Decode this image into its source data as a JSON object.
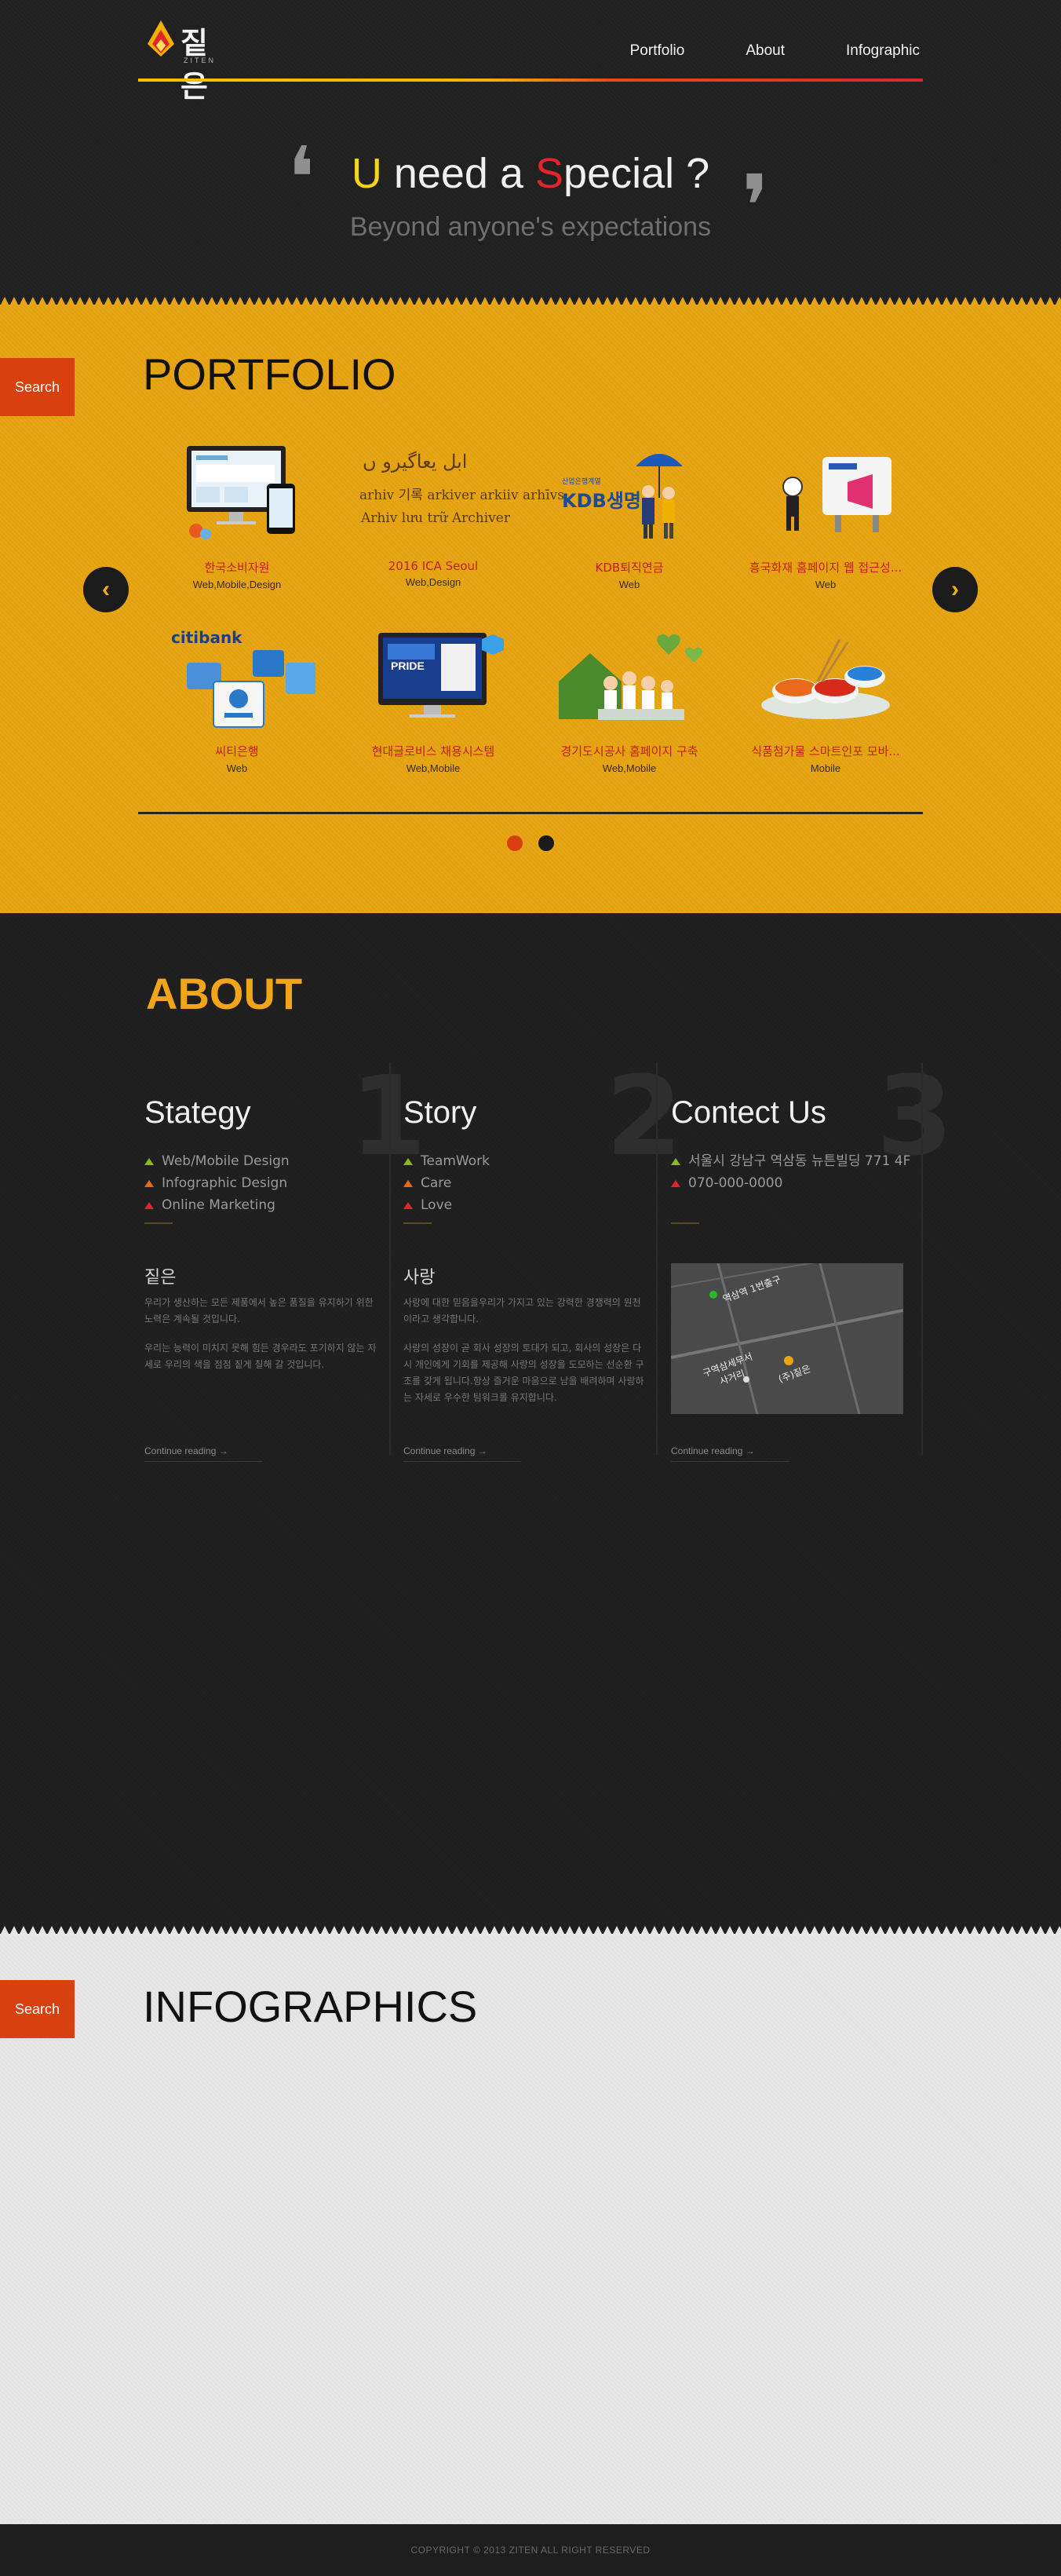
{
  "brand": {
    "name": "짙은",
    "sub": "ZITEN"
  },
  "nav": {
    "items": [
      "Portfolio",
      "About",
      "Infographic"
    ]
  },
  "hero": {
    "headline_u": "U",
    "headline_mid": " need a ",
    "headline_s": "S",
    "headline_rest": "pecial ?",
    "subline": "Beyond anyone's expectations",
    "quote_open": "❛",
    "quote_close": "❜"
  },
  "portfolio": {
    "search_label": "Search",
    "title": "PORTFOLIO",
    "prev_icon": "‹",
    "next_icon": "›",
    "items": [
      {
        "title": "한국소비자원",
        "cat": "Web,Mobile,Design"
      },
      {
        "title": "2016 ICA Seoul",
        "cat": "Web,Design"
      },
      {
        "title": "KDB퇴직연금",
        "cat": "Web"
      },
      {
        "title": "흥국화재 홈페이지 웹 접근성...",
        "cat": "Web"
      },
      {
        "title": "씨티은행",
        "cat": "Web"
      },
      {
        "title": "현대글로비스 채용시스템",
        "cat": "Web,Mobile"
      },
      {
        "title": "경기도시공사 홈페이지 구축",
        "cat": "Web,Mobile"
      },
      {
        "title": "식품첨가물 스마트인포 모바...",
        "cat": "Mobile"
      }
    ],
    "thumb_text": {
      "citi": "citibank",
      "kdb": "KDB생명",
      "kdb_small": "산업은행계열",
      "pride": "PRIDE",
      "archiv_line1": "ابل یعاگیرو ں",
      "archiv_line2": "arhiv 기록 arkiver arkiiv arhīvs",
      "archiv_line3": "Arhiv lưu trữ Archiver"
    },
    "dots": {
      "active_color": "#d84010",
      "inactive_color": "#1a1a1a"
    }
  },
  "about": {
    "title": "ABOUT",
    "columns": [
      {
        "num": "1",
        "title": "Stategy",
        "list": [
          "Web/Mobile Design",
          "Infographic Design",
          "Online Marketing"
        ],
        "sub": "짙은",
        "paragraphs": [
          "우리가 생산하는 모든 제품에서 높은 품질을 유지하기 위한 노력은 계속될 것입니다.",
          "우리는 능력이 미치지 못해 힘든 경우라도 포기하지 않는 자세로 우리의 색을 점점 짙게 칠해 갈 것입니다."
        ],
        "more": "Continue reading →"
      },
      {
        "num": "2",
        "title": "Story",
        "list": [
          "TeamWork",
          "Care",
          "Love"
        ],
        "sub": "사랑",
        "paragraphs": [
          "사랑에 대한 믿음을우리가 가지고 있는 강력한 경쟁력의 원천이라고 생각합니다.",
          "사랑의 성장이 곧 회사 성장의 토대가 되고, 회사의 성장은 다시 개인에게 기회를 제공해 사랑의 성장을 도모하는 선순환 구조를 갖게 됩니다.항상 즐거운 마음으로 남을 배려하며 사랑하는 자세로 우수한 팀워크를 유지합니다."
        ],
        "more": "Continue reading →"
      },
      {
        "num": "3",
        "title": "Contect Us",
        "list": [
          "서울시 강남구 역삼동 뉴튼빌딩 771 4F",
          "070-000-0000"
        ],
        "map_labels": [
          "역삼역 1번출구",
          "구역삼세무서 사거리",
          "(주)짙은"
        ],
        "more": "Continue reading →"
      }
    ]
  },
  "infographics": {
    "search_label": "Search",
    "title": "INFOGRAPHICS"
  },
  "footer": {
    "copyright": "COPYRIGHT © 2013 ZITEN ALL RIGHT RESERVED"
  },
  "colors": {
    "accent_yellow": "#e8a614",
    "accent_red": "#d84010",
    "about_title": "#f2a51a"
  }
}
